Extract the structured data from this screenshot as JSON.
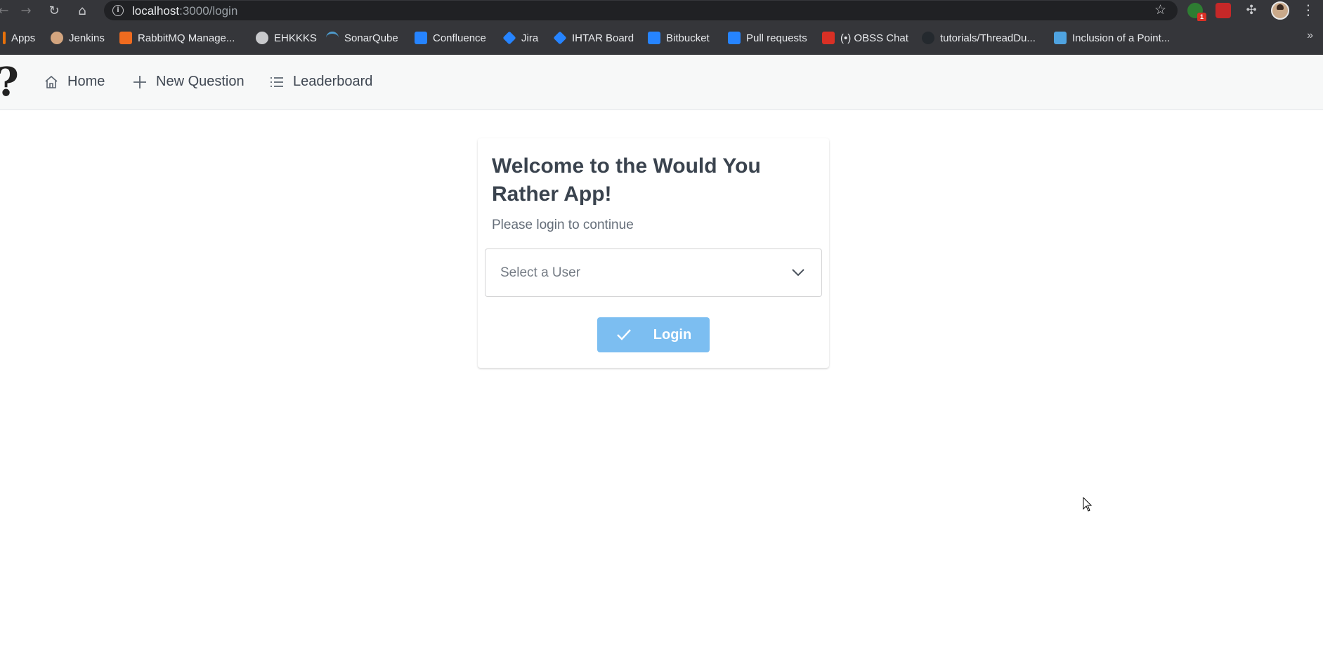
{
  "browser": {
    "url_host": "localhost",
    "url_path": ":3000/login",
    "extension_badge": "1",
    "bookmarks": [
      {
        "label": "Apps",
        "icon": "apps-grid-icon",
        "color": "#e8710a"
      },
      {
        "label": "Jenkins",
        "icon": "jenkins-icon",
        "color": "#d3a57f"
      },
      {
        "label": "RabbitMQ Manage...",
        "icon": "rabbitmq-icon",
        "color": "#f06b1f"
      },
      {
        "label": "EHKKKS",
        "icon": "globe-icon",
        "color": "#c8c9cc"
      },
      {
        "label": "SonarQube",
        "icon": "sonarqube-icon",
        "color": "#4e9bcd"
      },
      {
        "label": "Confluence",
        "icon": "confluence-icon",
        "color": "#2684ff"
      },
      {
        "label": "Jira",
        "icon": "jira-icon",
        "color": "#2684ff"
      },
      {
        "label": "IHTAR Board",
        "icon": "jira-icon",
        "color": "#2684ff"
      },
      {
        "label": "Bitbucket",
        "icon": "bitbucket-icon",
        "color": "#2684ff"
      },
      {
        "label": "Pull requests",
        "icon": "bitbucket-icon",
        "color": "#2684ff"
      },
      {
        "label": "(•) OBSS Chat",
        "icon": "chat-icon",
        "color": "#d93025"
      },
      {
        "label": "tutorials/ThreadDu...",
        "icon": "github-icon",
        "color": "#24292e"
      },
      {
        "label": "Inclusion of a Point...",
        "icon": "page-icon",
        "color": "#4fa3e0"
      }
    ]
  },
  "appnav": {
    "logo": "?",
    "items": [
      {
        "label": "Home",
        "icon": "home-icon"
      },
      {
        "label": "New Question",
        "icon": "plus-icon"
      },
      {
        "label": "Leaderboard",
        "icon": "list-icon"
      }
    ]
  },
  "login": {
    "title": "Welcome to the Would You Rather App!",
    "subtitle": "Please login to continue",
    "select_placeholder": "Select a User",
    "button_label": "Login",
    "button_color": "#7cbef1"
  }
}
